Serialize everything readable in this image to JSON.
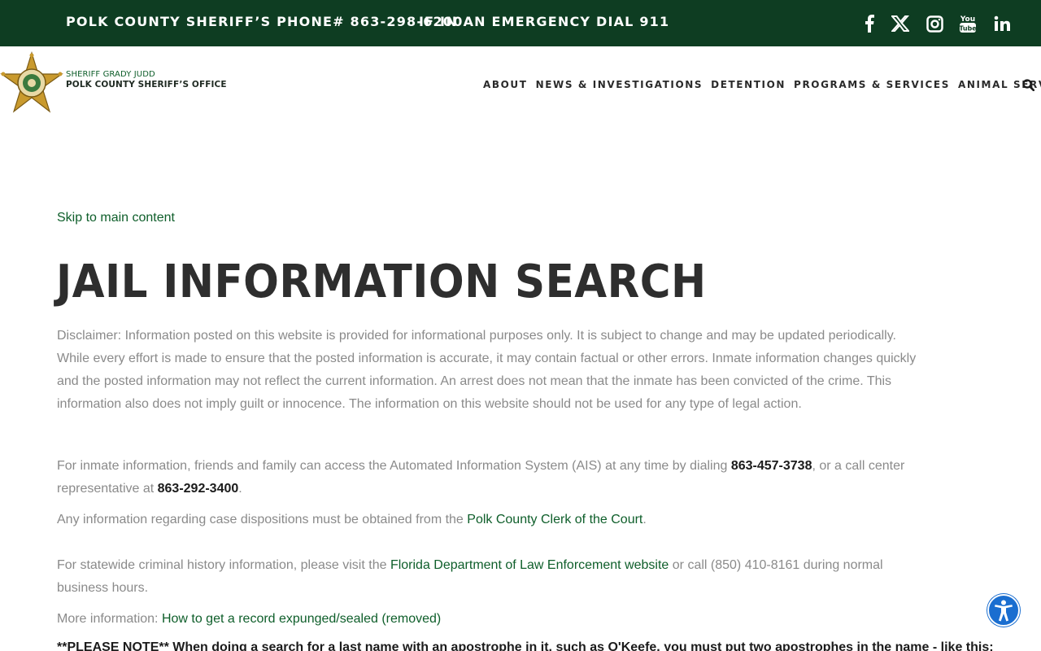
{
  "topbar": {
    "phone_text": "POLK COUNTY SHERIFF’S PHONE# 863-298-6200",
    "emergency_text": "IF IN AN EMERGENCY DIAL 911",
    "social_icons": [
      "facebook-icon",
      "x-icon",
      "instagram-icon",
      "youtube-icon",
      "linkedin-icon"
    ]
  },
  "header": {
    "brand_sub": "SHERIFF GRADY JUDD",
    "brand_main": "POLK COUNTY SHERIFF’S OFFICE",
    "nav": [
      "ABOUT",
      "NEWS & INVESTIGATIONS",
      "DETENTION",
      "PROGRAMS & SERVICES",
      "ANIMAL SERVICES"
    ]
  },
  "content": {
    "skip_link": "Skip to main content",
    "title": "JAIL INFORMATION SEARCH",
    "disclaimer_lines": [
      "Disclaimer: Information posted on this website is provided for informational purposes only. It is subject to change and may be updated periodically.",
      "While every effort is made to ensure that the posted information is accurate, it may contain factual or other errors. Inmate information changes quickly",
      "and the posted information may not reflect the current information. An arrest does not mean that the inmate has been convicted of the crime. This",
      "information also does not imply guilt or innocence.  The information on this website should not be used for any type of legal action."
    ],
    "ais_line1_a": "For inmate information, friends and family can access the Automated Information System (AIS) at any time by dialing ",
    "ais_phone1": "863-457-3738",
    "ais_line1_b": ", or a call center",
    "ais_line2_a": "representative at ",
    "ais_phone2": "863-292-3400",
    "ais_line2_b": ".",
    "dispositions_text": "Any information regarding case dispositions must be obtained from the ",
    "dispositions_link": "Polk County Clerk of the Court",
    "dispositions_end": ".",
    "statewide_text": "For statewide criminal history information, please visit the ",
    "statewide_link": "Florida Department of Law Enforcement website",
    "statewide_end": " or call (850) 410-8161 during normal",
    "statewide_line2": "business hours.",
    "more_info_label": "More information: ",
    "more_info_link": "How to get a record expunged/sealed (removed)",
    "note": "**PLEASE NOTE** When doing a search for a last name with an apostrophe in it, such as O'Keefe, you must put two apostrophes in the name - like this:"
  },
  "colors": {
    "topbar_bg": "#0e3d22",
    "link": "#0e5e2a",
    "accessibility": "#1a6ed0"
  }
}
